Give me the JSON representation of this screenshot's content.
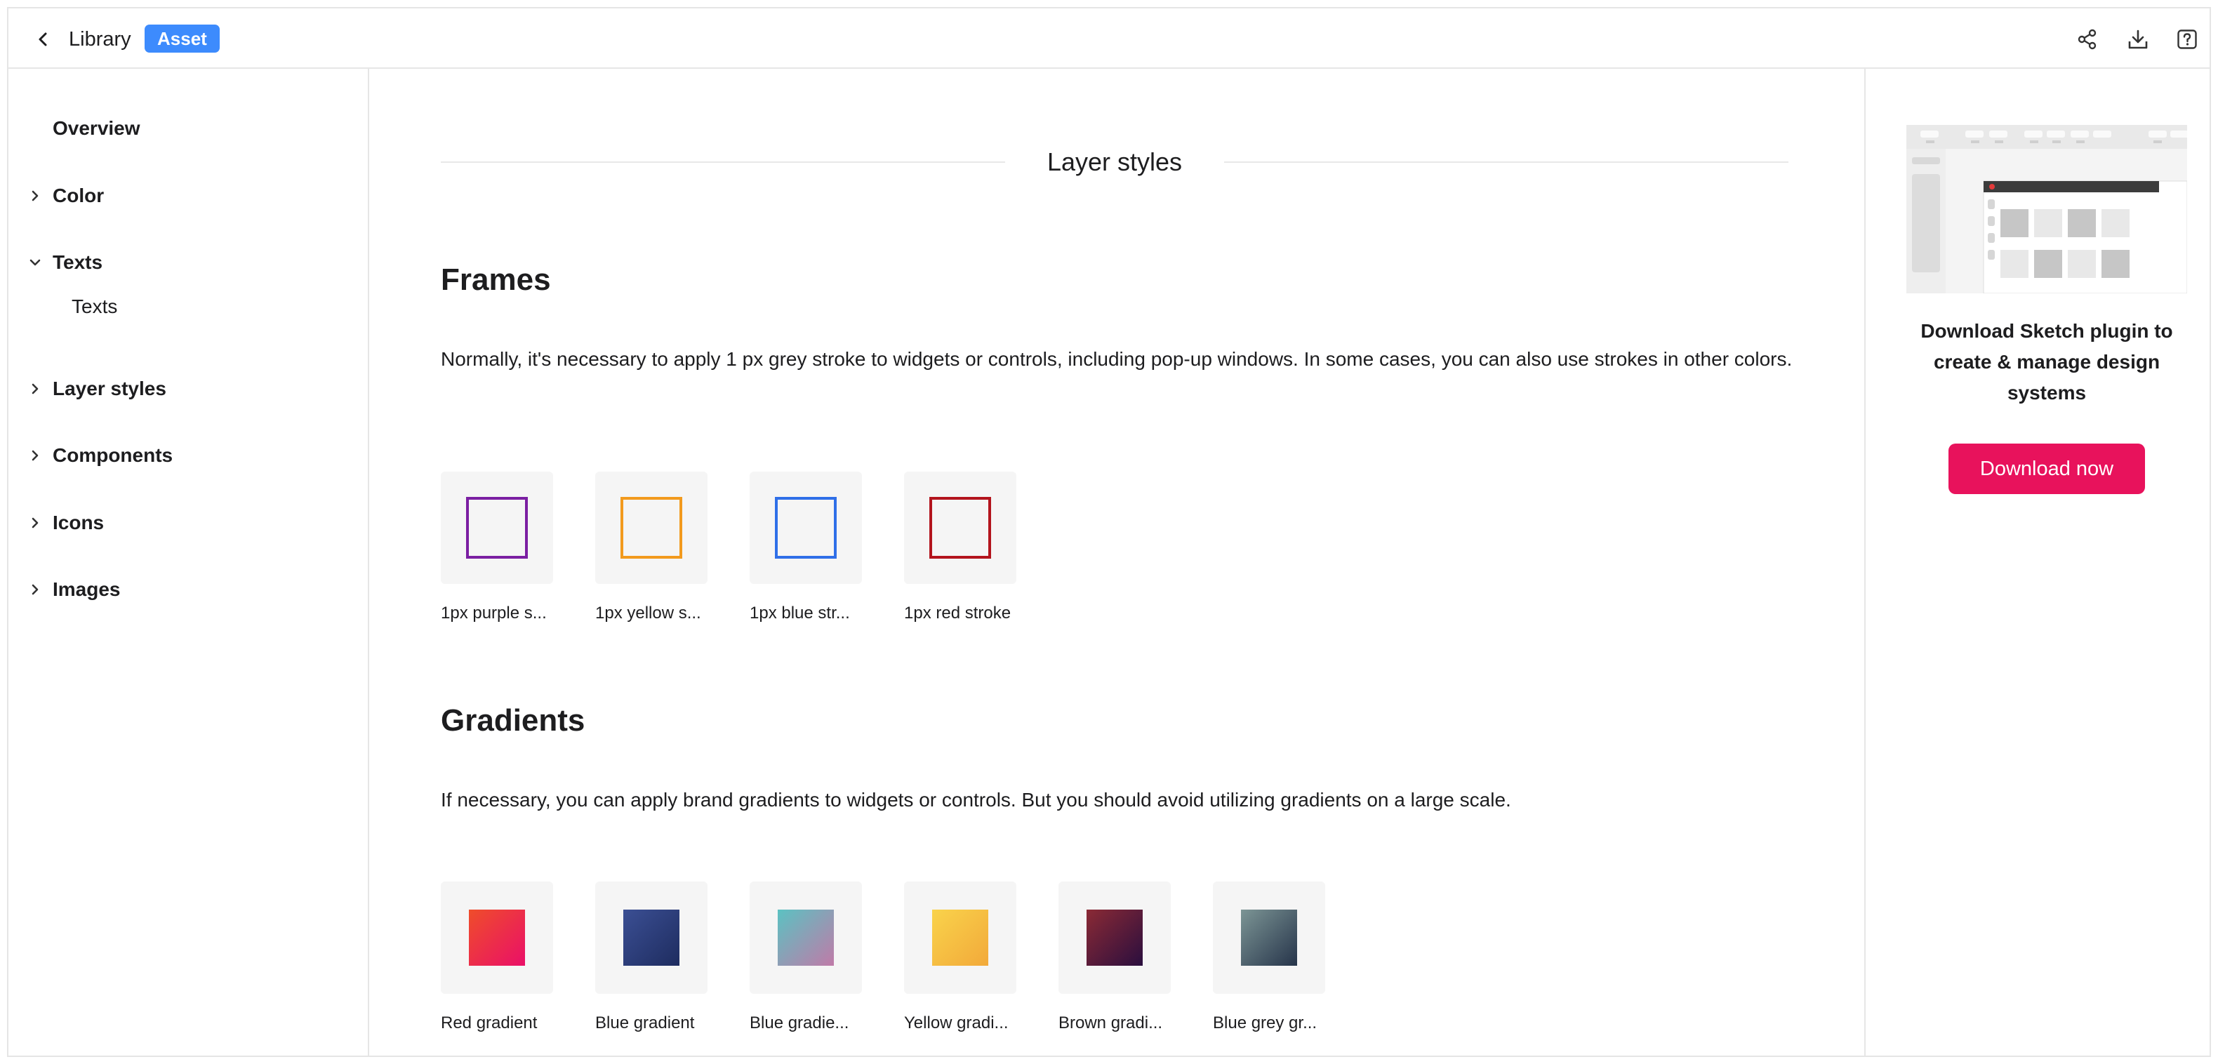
{
  "header": {
    "title": "Library",
    "badge": "Asset",
    "icons": [
      "back-icon",
      "share-icon",
      "download-icon",
      "help-icon"
    ]
  },
  "sidebar": {
    "items": [
      {
        "label": "Overview",
        "expanded": null
      },
      {
        "label": "Color",
        "expanded": false
      },
      {
        "label": "Texts",
        "expanded": true,
        "children": [
          "Texts"
        ]
      },
      {
        "label": "Layer styles",
        "expanded": false
      },
      {
        "label": "Components",
        "expanded": false
      },
      {
        "label": "Icons",
        "expanded": false
      },
      {
        "label": "Images",
        "expanded": false
      }
    ]
  },
  "main": {
    "section_title": "Layer styles",
    "frames": {
      "heading": "Frames",
      "description": "Normally, it's necessary to apply 1 px grey stroke to widgets or controls, including pop-up windows. In some cases, you can also use strokes in other colors.",
      "tiles": [
        {
          "label": "1px purple s...",
          "color": "#7b1fa2"
        },
        {
          "label": "1px yellow s...",
          "color": "#f29a1d"
        },
        {
          "label": "1px blue str...",
          "color": "#2f6fe8"
        },
        {
          "label": "1px red stroke",
          "color": "#b3141d"
        }
      ]
    },
    "gradients": {
      "heading": "Gradients",
      "description": "If necessary, you can apply brand gradients to widgets or controls. But you should avoid utilizing gradients on a large scale.",
      "tiles": [
        {
          "label": "Red gradient",
          "from": "#ef4d2a",
          "to": "#ea0f68"
        },
        {
          "label": "Blue gradient",
          "from": "#3b4f94",
          "to": "#1e2c5f"
        },
        {
          "label": "Blue gradie...",
          "from": "#5bc2c2",
          "to": "#c07aa8"
        },
        {
          "label": "Yellow gradi...",
          "from": "#f9d34b",
          "to": "#f2a93a"
        },
        {
          "label": "Brown gradi...",
          "from": "#8b2a35",
          "to": "#2a0e3e"
        },
        {
          "label": "Blue grey gr...",
          "from": "#7c9595",
          "to": "#26344a"
        }
      ]
    }
  },
  "promo": {
    "text": "Download Sketch plugin to create & manage design systems",
    "button": "Download now",
    "accent": "#e8125c"
  }
}
